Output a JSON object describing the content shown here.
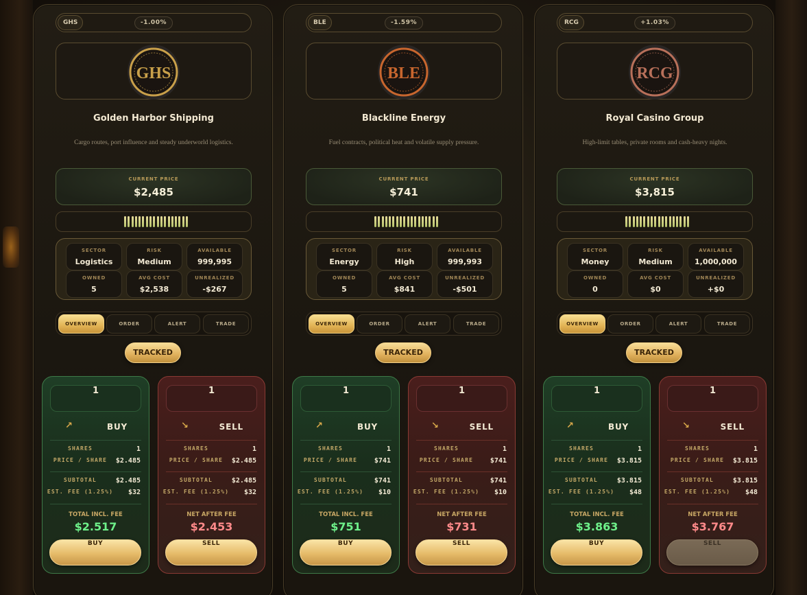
{
  "cards": [
    {
      "ticker": "GHS",
      "change": "-1.00%",
      "logo_text": "GHS",
      "logo_color": "#c9a04a",
      "name": "Golden Harbor Shipping",
      "description": "Cargo routes, port influence and steady underworld logistics.",
      "price_label": "CURRENT PRICE",
      "price": "$2,485",
      "stats": [
        {
          "label": "SECTOR",
          "value": "Logistics"
        },
        {
          "label": "RISK",
          "value": "Medium"
        },
        {
          "label": "AVAILABLE",
          "value": "999,995"
        },
        {
          "label": "OWNED",
          "value": "5"
        },
        {
          "label": "AVG COST",
          "value": "$2,538"
        },
        {
          "label": "UNREALIZED",
          "value": "-$267"
        }
      ],
      "tabs": [
        "OVERVIEW",
        "ORDER",
        "ALERT",
        "TRADE"
      ],
      "tracked": "TRACKED",
      "buy": {
        "qty": "1",
        "arrow": "↗",
        "action": "BUY",
        "shares_label": "SHARES",
        "shares": "1",
        "pps_label": "PRICE / SHARE",
        "pps": "$2.485",
        "subtotal_label": "SUBTOTAL",
        "subtotal": "$2.485",
        "fee_label": "EST. FEE (1.25%)",
        "fee": "$32",
        "total_label": "TOTAL INCL. FEE",
        "total": "$2.517",
        "button": "BUY"
      },
      "sell": {
        "qty": "1",
        "arrow": "↘",
        "action": "SELL",
        "shares_label": "SHARES",
        "shares": "1",
        "pps_label": "PRICE / SHARE",
        "pps": "$2.485",
        "subtotal_label": "SUBTOTAL",
        "subtotal": "$2.485",
        "fee_label": "EST. FEE (1.25%)",
        "fee": "$32",
        "total_label": "NET AFTER FEE",
        "total": "$2.453",
        "button": "SELL"
      }
    },
    {
      "ticker": "BLE",
      "change": "-1.59%",
      "logo_text": "BLE",
      "logo_color": "#c8662e",
      "name": "Blackline Energy",
      "description": "Fuel contracts, political heat and volatile supply pressure.",
      "price_label": "CURRENT PRICE",
      "price": "$741",
      "stats": [
        {
          "label": "SECTOR",
          "value": "Energy"
        },
        {
          "label": "RISK",
          "value": "High"
        },
        {
          "label": "AVAILABLE",
          "value": "999,993"
        },
        {
          "label": "OWNED",
          "value": "5"
        },
        {
          "label": "AVG COST",
          "value": "$841"
        },
        {
          "label": "UNREALIZED",
          "value": "-$501"
        }
      ],
      "tabs": [
        "OVERVIEW",
        "ORDER",
        "ALERT",
        "TRADE"
      ],
      "tracked": "TRACKED",
      "buy": {
        "qty": "1",
        "arrow": "↗",
        "action": "BUY",
        "shares_label": "SHARES",
        "shares": "1",
        "pps_label": "PRICE / SHARE",
        "pps": "$741",
        "subtotal_label": "SUBTOTAL",
        "subtotal": "$741",
        "fee_label": "EST. FEE (1.25%)",
        "fee": "$10",
        "total_label": "TOTAL INCL. FEE",
        "total": "$751",
        "button": "BUY"
      },
      "sell": {
        "qty": "1",
        "arrow": "↘",
        "action": "SELL",
        "shares_label": "SHARES",
        "shares": "1",
        "pps_label": "PRICE / SHARE",
        "pps": "$741",
        "subtotal_label": "SUBTOTAL",
        "subtotal": "$741",
        "fee_label": "EST. FEE (1.25%)",
        "fee": "$10",
        "total_label": "NET AFTER FEE",
        "total": "$731",
        "button": "SELL"
      }
    },
    {
      "ticker": "RCG",
      "change": "+1.03%",
      "logo_text": "RCG",
      "logo_color": "#b8705a",
      "name": "Royal Casino Group",
      "description": "High-limit tables, private rooms and cash-heavy nights.",
      "price_label": "CURRENT PRICE",
      "price": "$3,815",
      "stats": [
        {
          "label": "SECTOR",
          "value": "Money"
        },
        {
          "label": "RISK",
          "value": "Medium"
        },
        {
          "label": "AVAILABLE",
          "value": "1,000,000"
        },
        {
          "label": "OWNED",
          "value": "0"
        },
        {
          "label": "AVG COST",
          "value": "$0"
        },
        {
          "label": "UNREALIZED",
          "value": "+$0"
        }
      ],
      "tabs": [
        "OVERVIEW",
        "ORDER",
        "ALERT",
        "TRADE"
      ],
      "tracked": "TRACKED",
      "buy": {
        "qty": "1",
        "arrow": "↗",
        "action": "BUY",
        "shares_label": "SHARES",
        "shares": "1",
        "pps_label": "PRICE / SHARE",
        "pps": "$3.815",
        "subtotal_label": "SUBTOTAL",
        "subtotal": "$3.815",
        "fee_label": "EST. FEE (1.25%)",
        "fee": "$48",
        "total_label": "TOTAL INCL. FEE",
        "total": "$3.863",
        "button": "BUY"
      },
      "sell": {
        "qty": "1",
        "arrow": "↘",
        "action": "SELL",
        "shares_label": "SHARES",
        "shares": "1",
        "pps_label": "PRICE / SHARE",
        "pps": "$3.815",
        "subtotal_label": "SUBTOTAL",
        "subtotal": "$3.815",
        "fee_label": "EST. FEE (1.25%)",
        "fee": "$48",
        "total_label": "NET AFTER FEE",
        "total": "$3.767",
        "button": "SELL",
        "disabled": true
      }
    }
  ],
  "colors": {
    "gold_accent": "#e2b455",
    "buy_green": "#6ef08a",
    "sell_red": "#ff8a8a"
  }
}
